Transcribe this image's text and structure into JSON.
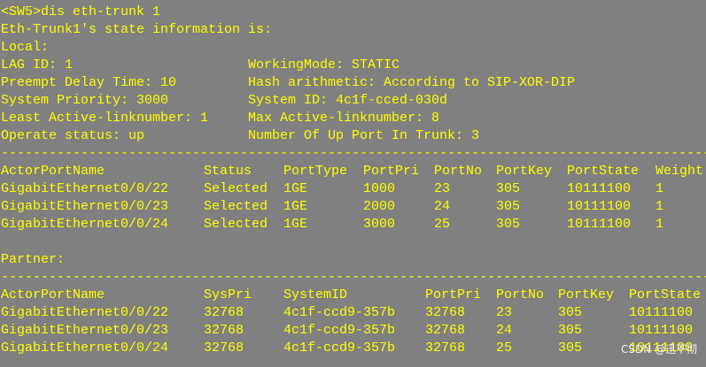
{
  "colors": {
    "background": "#808080",
    "text": "#ffff00",
    "watermark": "#ffffff"
  },
  "terminal": {
    "command": "<SW5>dis eth-trunk 1",
    "header": "Eth-Trunk1's state information is:",
    "local_label": "Local:",
    "info": [
      {
        "left": "LAG ID: 1",
        "right": "WorkingMode: STATIC"
      },
      {
        "left": "Preempt Delay Time: 10",
        "right": "Hash arithmetic: According to SIP-XOR-DIP"
      },
      {
        "left": "System Priority: 3000",
        "right": "System ID: 4c1f-cced-030d"
      },
      {
        "left": "Least Active-linknumber: 1",
        "right": "Max Active-linknumber: 8"
      },
      {
        "left": "Operate status: up",
        "right": "Number Of Up Port In Trunk: 3"
      }
    ],
    "divider": "--------------------------------------------------------------------------------------------------------------",
    "local_table": {
      "headers": [
        "ActorPortName",
        "Status",
        "PortType",
        "PortPri",
        "PortNo",
        "PortKey",
        "PortState",
        "Weight"
      ],
      "rows": [
        [
          "GigabitEthernet0/0/22",
          "Selected",
          "1GE",
          "1000",
          "23",
          "305",
          "10111100",
          "1"
        ],
        [
          "GigabitEthernet0/0/23",
          "Selected",
          "1GE",
          "2000",
          "24",
          "305",
          "10111100",
          "1"
        ],
        [
          "GigabitEthernet0/0/24",
          "Selected",
          "1GE",
          "3000",
          "25",
          "305",
          "10111100",
          "1"
        ]
      ]
    },
    "partner_label": "Partner:",
    "partner_table": {
      "headers": [
        "ActorPortName",
        "SysPri",
        "SystemID",
        "PortPri",
        "PortNo",
        "PortKey",
        "PortState"
      ],
      "rows": [
        [
          "GigabitEthernet0/0/22",
          "32768",
          "4c1f-ccd9-357b",
          "32768",
          "23",
          "305",
          "10111100"
        ],
        [
          "GigabitEthernet0/0/23",
          "32768",
          "4c1f-ccd9-357b",
          "32768",
          "24",
          "305",
          "10111100"
        ],
        [
          "GigabitEthernet0/0/24",
          "32768",
          "4c1f-ccd9-357b",
          "32768",
          "25",
          "305",
          "10111100"
        ]
      ]
    }
  },
  "watermark": "CSDN @迅不彻"
}
